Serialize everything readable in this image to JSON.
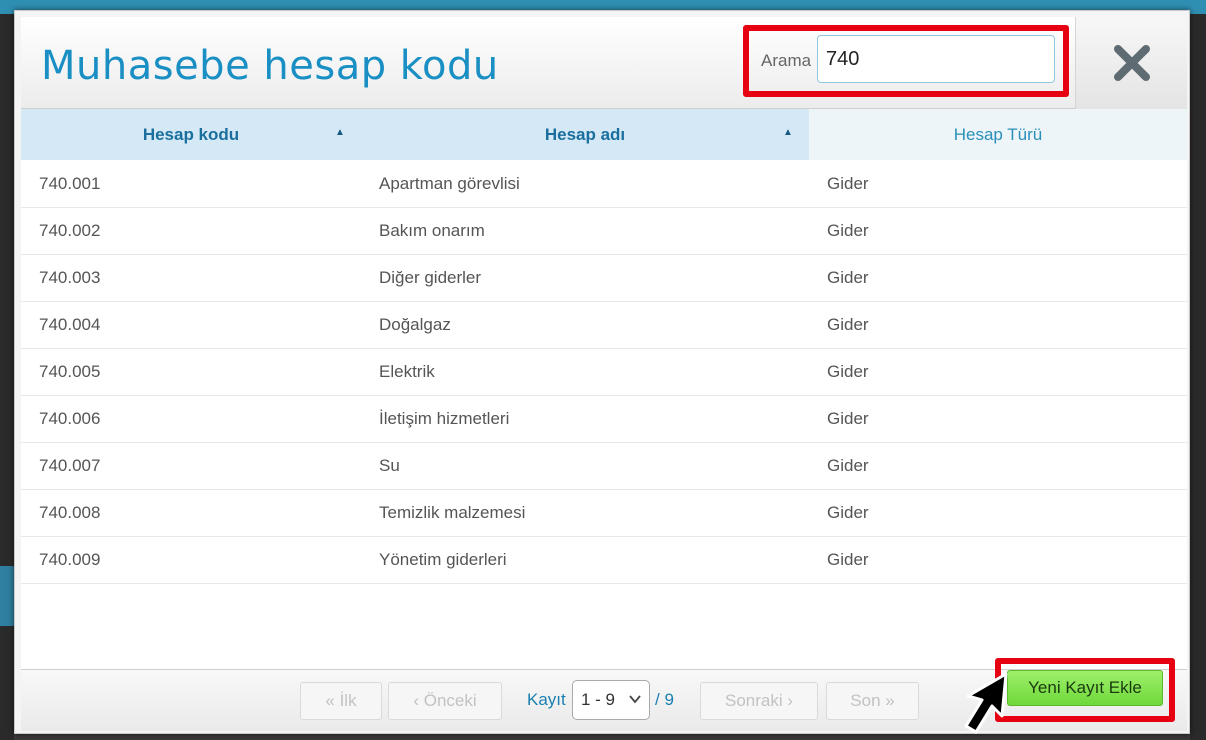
{
  "dialog": {
    "title": "Muhasebe hesap kodu",
    "search": {
      "label": "Arama",
      "value": "740"
    }
  },
  "table": {
    "headers": {
      "code": "Hesap kodu",
      "name": "Hesap adı",
      "type": "Hesap Türü"
    },
    "rows": [
      {
        "code": "740.001",
        "name": "Apartman görevlisi",
        "type": "Gider"
      },
      {
        "code": "740.002",
        "name": "Bakım onarım",
        "type": "Gider"
      },
      {
        "code": "740.003",
        "name": "Diğer giderler",
        "type": "Gider"
      },
      {
        "code": "740.004",
        "name": "Doğalgaz",
        "type": "Gider"
      },
      {
        "code": "740.005",
        "name": "Elektrik",
        "type": "Gider"
      },
      {
        "code": "740.006",
        "name": "İletişim hizmetleri",
        "type": "Gider"
      },
      {
        "code": "740.007",
        "name": "Su",
        "type": "Gider"
      },
      {
        "code": "740.008",
        "name": "Temizlik malzemesi",
        "type": "Gider"
      },
      {
        "code": "740.009",
        "name": "Yönetim giderleri",
        "type": "Gider"
      }
    ]
  },
  "pagination": {
    "first": "« İlk",
    "prev": "‹ Önceki",
    "record_label": "Kayıt",
    "range": "1 - 9",
    "total": "/ 9",
    "next": "Sonraki ›",
    "last": "Son »"
  },
  "actions": {
    "new_record": "Yeni Kayıt Ekle"
  },
  "colors": {
    "accent": "#1a8fc4",
    "highlight": "#e60012",
    "new_button": "#7ee04a",
    "header_sorted": "#d4e9f5"
  },
  "icons": {
    "close": "close-icon",
    "sort": "sort-asc-icon",
    "dropdown": "chevron-down-icon",
    "pointer": "mouse-cursor-icon"
  }
}
